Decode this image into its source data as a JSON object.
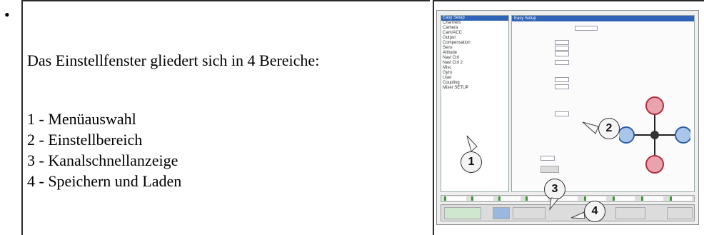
{
  "intro": "Das Einstellfenster gliedert sich in 4 Bereiche:",
  "items": [
    "1 - Menüauswahl",
    "2 - Einstellbereich",
    "3 - Kanalschnellanzeige",
    "4 - Speichern und Laden"
  ],
  "screenshot": {
    "menu_items": [
      "Easy Setup",
      "Channels",
      "Camera",
      "Cam/ACC",
      "Output",
      "Compensation",
      "Sens",
      "Altitude",
      "Navi Ctrl",
      "Navi Ctrl 2",
      "Misc",
      "Gyro",
      "User",
      "Coupling",
      "Mixer SETUP"
    ],
    "panel_title": "Easy Setup",
    "badges": [
      "1",
      "2",
      "3",
      "4"
    ]
  }
}
